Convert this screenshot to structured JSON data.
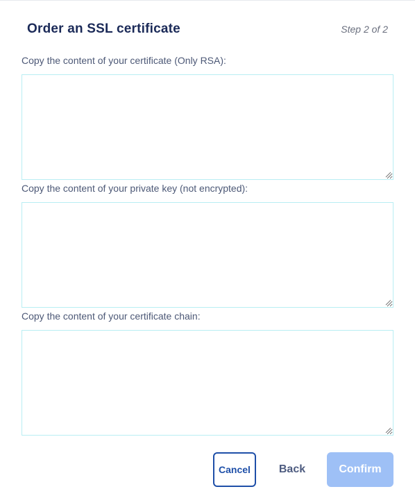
{
  "dialog": {
    "title": "Order an SSL certificate",
    "step": "Step 2 of 2"
  },
  "fields": {
    "certificate": {
      "label": "Copy the content of your certificate (Only RSA):",
      "value": ""
    },
    "private_key": {
      "label": "Copy the content of your private key (not encrypted):",
      "value": ""
    },
    "chain": {
      "label": "Copy the content of your certificate chain:",
      "value": ""
    }
  },
  "actions": {
    "cancel_label": "Cancel",
    "back_label": "Back",
    "confirm_label": "Confirm"
  },
  "colors": {
    "title": "#1b2a58",
    "field_border": "#b8eef3",
    "primary": "#1e4fa8",
    "confirm_disabled": "#9ec0f6"
  },
  "icons": {
    "resize_grip": "resize-grip-icon"
  }
}
